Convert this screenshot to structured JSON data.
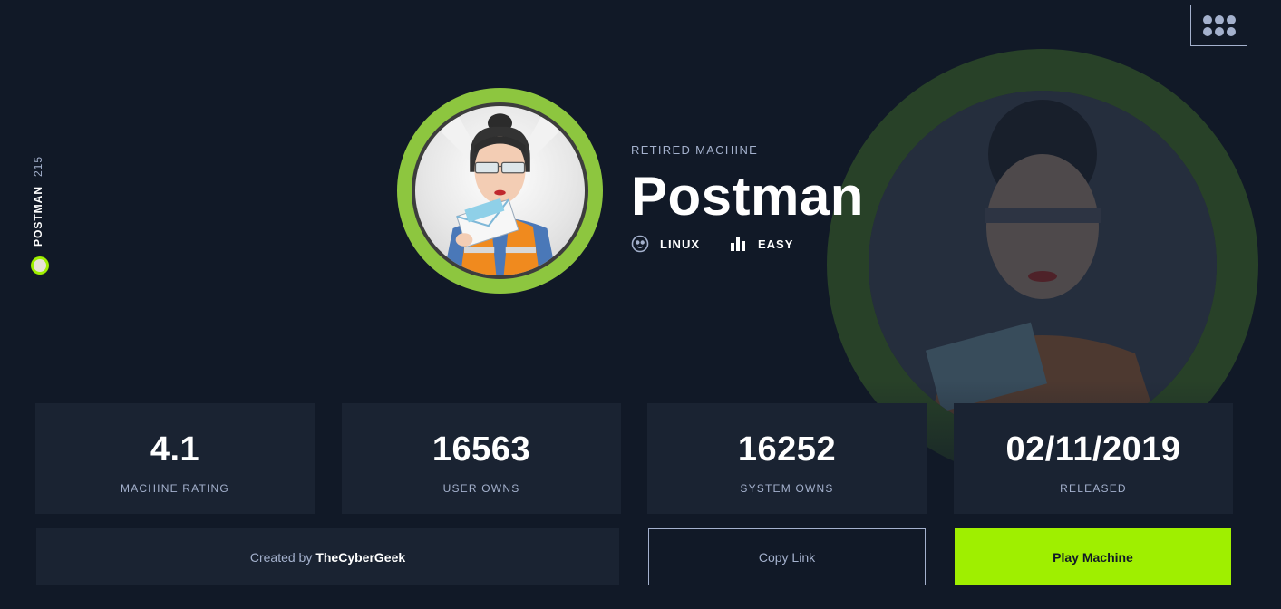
{
  "colors": {
    "background": "#111927",
    "card": "#1a2332",
    "accent": "#9fef00",
    "muted_text": "#a4b1cd",
    "avatar_ring": "#8dc63f"
  },
  "header": {
    "apps_icon": "apps-grid-icon"
  },
  "sidebar": {
    "machine_name": "POSTMAN",
    "machine_number": "215",
    "icon": "machine-avatar-icon"
  },
  "machine": {
    "status": "RETIRED MACHINE",
    "name": "Postman",
    "os": "LINUX",
    "os_icon": "linux-penguin-icon",
    "difficulty": "EASY",
    "difficulty_icon": "difficulty-bars-icon"
  },
  "stats": [
    {
      "value": "4.1",
      "label": "MACHINE RATING"
    },
    {
      "value": "16563",
      "label": "USER OWNS"
    },
    {
      "value": "16252",
      "label": "SYSTEM OWNS"
    },
    {
      "value": "02/11/2019",
      "label": "RELEASED"
    }
  ],
  "footer": {
    "created_prefix": "Created by",
    "author": "TheCyberGeek",
    "copy_link_label": "Copy Link",
    "play_label": "Play Machine"
  }
}
